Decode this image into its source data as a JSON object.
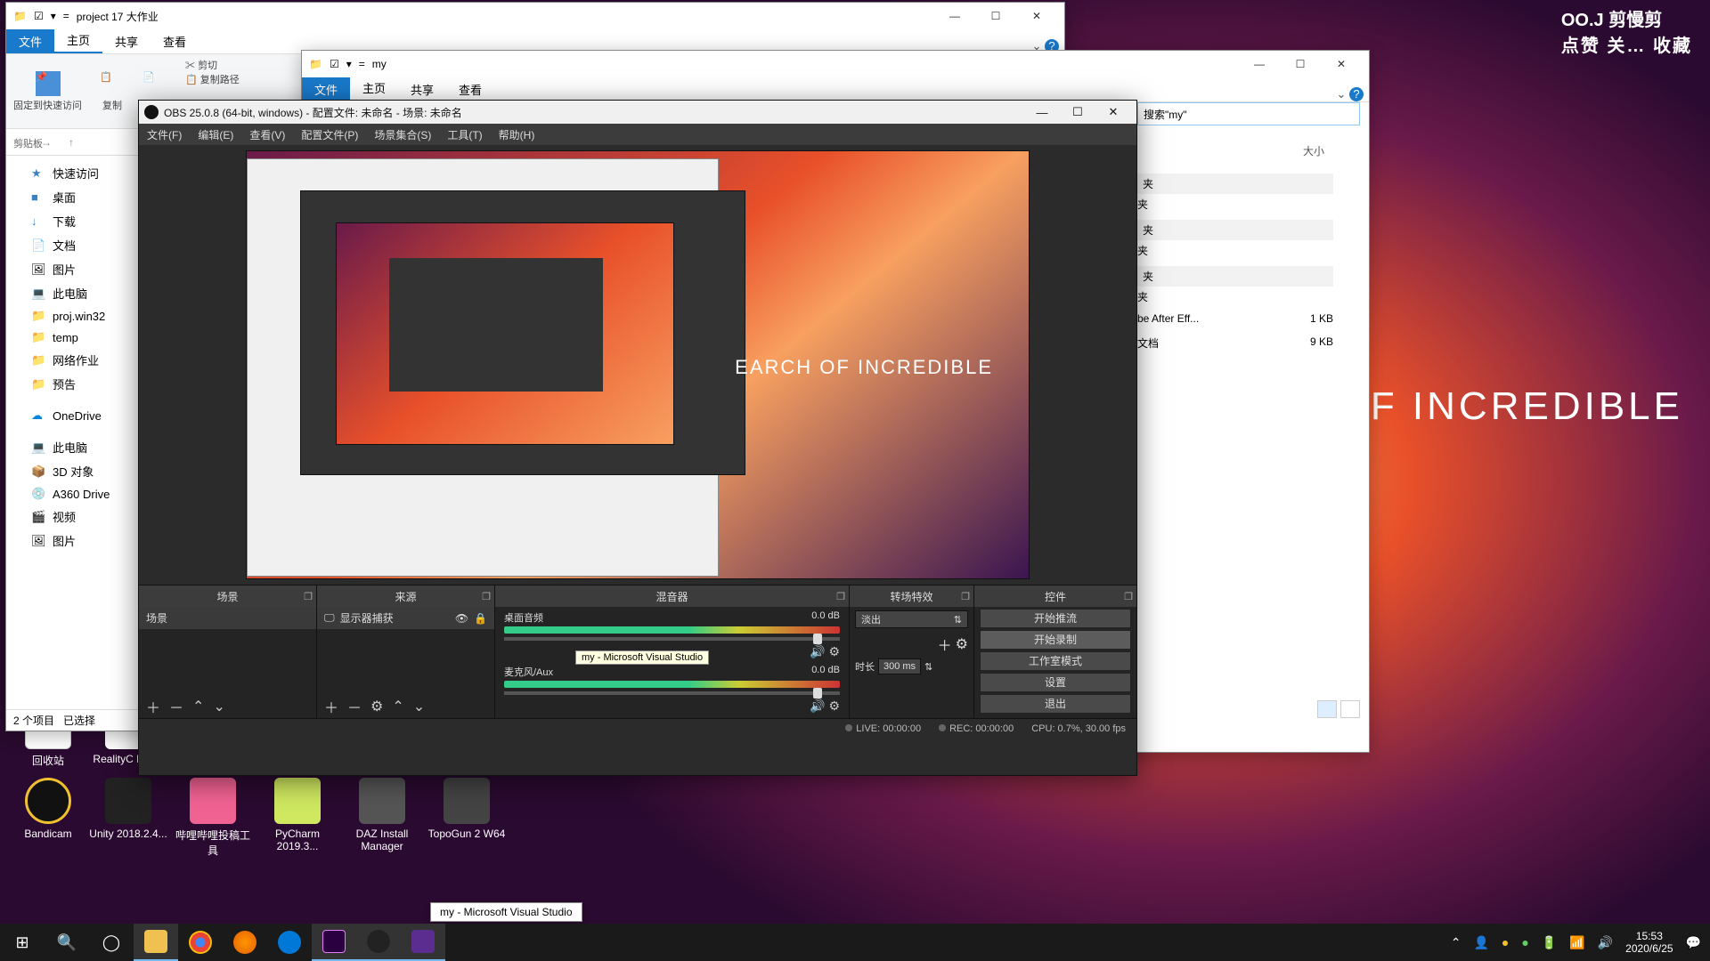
{
  "desktop": {
    "brand_text": "EARCH OF INCREDIBLE",
    "watermark_line1": "OO.J 剪慢剪",
    "watermark_line2": "点赞 关… 收藏",
    "icons": {
      "recycle": "回收站",
      "reality": "RealityC BETA",
      "bandicam": "Bandicam",
      "unity": "Unity 2018.2.4...",
      "bili": "哔哩哔哩投稿工具",
      "pycharm": "PyCharm 2019.3...",
      "daz": "DAZ Install Manager",
      "topo": "TopoGun 2 W64"
    }
  },
  "explorer1": {
    "title": "project 17 大作业",
    "tabs": {
      "file": "文件",
      "home": "主页",
      "share": "共享",
      "view": "查看"
    },
    "ribbon": {
      "pin": "固定到快速访问",
      "copy": "复制",
      "paste": "粘贴",
      "cut": "剪切",
      "copy_path": "复制路径",
      "clipboard_group": "剪贴板"
    },
    "sidebar": {
      "quick": "快速访问",
      "desktop": "桌面",
      "downloads": "下载",
      "documents": "文档",
      "pictures": "图片",
      "thispc": "此电脑",
      "proj": "proj.win32",
      "temp": "temp",
      "nethw": "网络作业",
      "preview": "预告",
      "onedrive": "OneDrive",
      "thispc2": "此电脑",
      "3d": "3D 对象",
      "a360": "A360 Drive",
      "video": "视频",
      "pics2": "图片"
    },
    "statusbar": {
      "items": "2 个项目",
      "selected": "已选择"
    }
  },
  "explorer2": {
    "title": "my",
    "tabs": {
      "file": "文件",
      "home": "主页",
      "share": "共享",
      "view": "查看"
    },
    "search_placeholder": "搜索\"my\"",
    "col_size": "大小",
    "rows": [
      {
        "name": "夹",
        "size": ""
      },
      {
        "name": "夹",
        "size": ""
      },
      {
        "name": "夹",
        "size": ""
      },
      {
        "name": "夹",
        "size": ""
      },
      {
        "name": "夹",
        "size": ""
      },
      {
        "name": "夹",
        "size": ""
      },
      {
        "name": "be After Eff...",
        "size": "1 KB"
      },
      {
        "name": "文档",
        "size": "9 KB"
      }
    ]
  },
  "obs": {
    "title": "OBS 25.0.8 (64-bit, windows) - 配置文件: 未命名 - 场景: 未命名",
    "menu": {
      "file": "文件(F)",
      "edit": "编辑(E)",
      "view": "查看(V)",
      "profile": "配置文件(P)",
      "scenes": "场景集合(S)",
      "tools": "工具(T)",
      "help": "帮助(H)"
    },
    "preview_tooltip": "my - Microsoft Visual Studio",
    "preview_brand": "EARCH OF INCREDIBLE",
    "docks": {
      "scenes": "场景",
      "sources": "来源",
      "mixer": "混音器",
      "transitions": "转场特效",
      "controls": "控件"
    },
    "scene_item": "场景",
    "source_item": "显示器捕获",
    "mixer": {
      "ch1_name": "桌面音频",
      "ch1_db": "0.0 dB",
      "ch2_name": "麦克风/Aux",
      "ch2_db": "0.0 dB"
    },
    "transition": {
      "selected": "淡出",
      "duration_label": "时长",
      "duration_value": "300 ms"
    },
    "controls": {
      "stream": "开始推流",
      "record": "开始录制",
      "studio": "工作室模式",
      "settings": "设置",
      "exit": "退出"
    },
    "status": {
      "live": "LIVE: 00:00:00",
      "rec": "REC: 00:00:00",
      "cpu": "CPU: 0.7%, 30.00 fps"
    }
  },
  "taskbar": {
    "tooltip": "my - Microsoft Visual Studio",
    "clock_time": "15:53",
    "clock_date": "2020/6/25"
  }
}
